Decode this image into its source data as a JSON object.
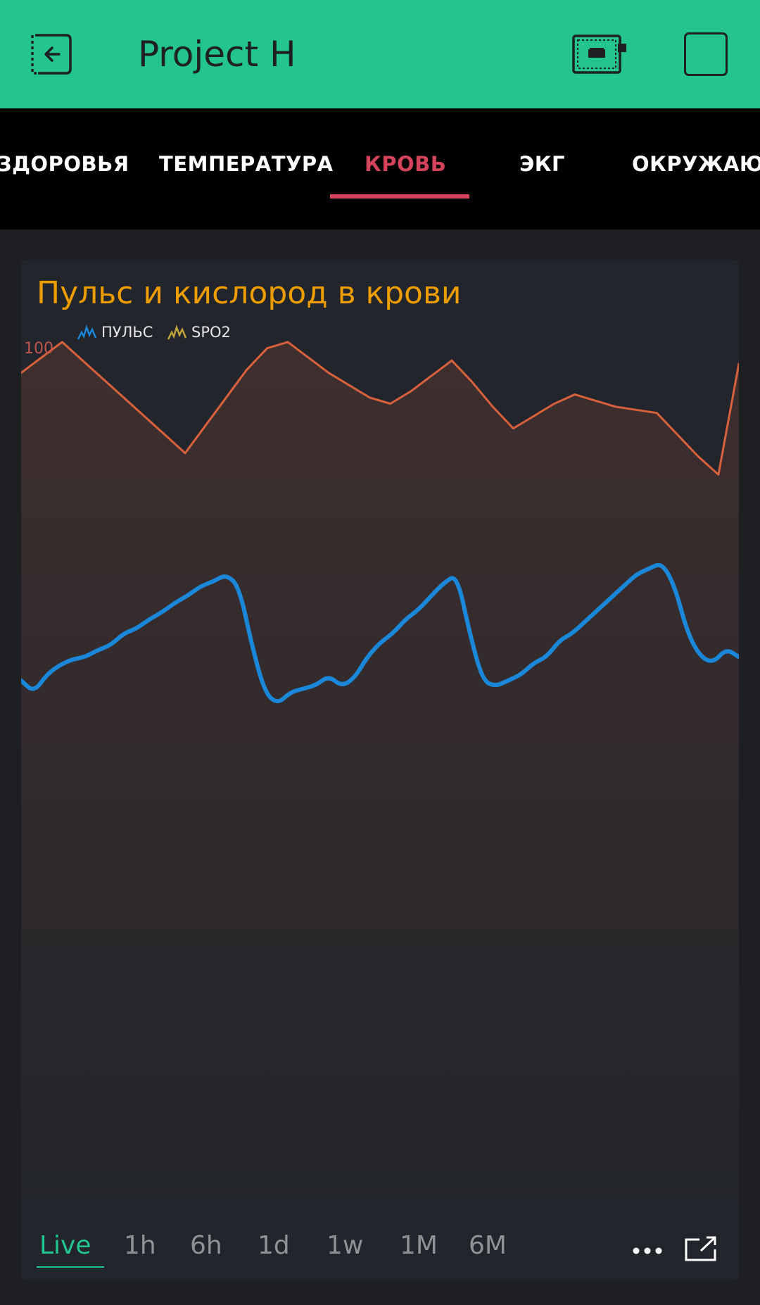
{
  "header": {
    "title": "Project H",
    "colors": {
      "bar": "#23c48e",
      "icon": "#1e2023"
    },
    "icons": {
      "back": "exit-door-icon",
      "device": "device-board-icon",
      "square": "square-icon"
    }
  },
  "tabs": {
    "items": [
      {
        "label": "ЗДОРОВЬЯ"
      },
      {
        "label": "ТЕМПЕРАТУРА"
      },
      {
        "label": "КРОВЬ",
        "active": true
      },
      {
        "label": "ЭКГ"
      },
      {
        "label": "ОКРУЖАЮЩ"
      }
    ],
    "active_color": "#d3435c"
  },
  "card": {
    "title": "Пульс и кислород в крови",
    "title_color": "#ed9d00",
    "legend": [
      {
        "label": "ПУЛЬС",
        "color": "#1a87d8"
      },
      {
        "label": "SPO2",
        "color": "#c0a43c"
      }
    ],
    "ymax_label": "100"
  },
  "chart_data": {
    "type": "line",
    "title": "Пульс и кислород в крови",
    "legend_position": "top-left",
    "grid": false,
    "x": [
      0,
      1,
      2,
      3,
      4,
      5,
      6,
      7,
      8,
      9,
      10,
      11,
      12,
      13,
      14,
      15,
      16,
      17,
      18,
      19,
      20,
      21,
      22,
      23,
      24,
      25,
      26,
      27,
      28,
      29,
      30,
      31,
      32,
      33,
      34,
      35,
      36,
      37,
      38,
      39,
      40,
      41,
      42,
      43,
      44,
      45,
      46,
      47,
      48,
      49,
      50,
      51,
      52,
      53,
      54,
      55,
      56,
      57,
      58,
      59,
      60
    ],
    "ylim": [
      0,
      100
    ],
    "series": [
      {
        "name": "SPO2",
        "color": "#d8613d",
        "fill": true,
        "values": [
          99,
          99.5,
          100,
          99.4,
          98.8,
          98.2,
          97.6,
          97,
          96.4,
          97.3,
          98.2,
          99.1,
          99.8,
          100,
          99.5,
          99,
          98.6,
          98.2,
          98,
          98.4,
          98.9,
          99.4,
          98.7,
          97.9,
          97.2,
          97.6,
          98,
          98.3,
          98.1,
          97.9,
          97.8,
          97.7,
          97,
          96.3,
          95.7,
          99.3
        ]
      },
      {
        "name": "ПУЛЬС",
        "color": "#1a87d8",
        "fill": false,
        "values": [
          62,
          61,
          62.5,
          63.3,
          63.8,
          64,
          64.6,
          65,
          66,
          66.4,
          67.2,
          67.8,
          68.6,
          69.2,
          70,
          70.4,
          71,
          70,
          65,
          61,
          60,
          61,
          61.3,
          61.6,
          62.4,
          61.5,
          62.2,
          64,
          65.2,
          66,
          67.2,
          68,
          69.2,
          70.3,
          71,
          66,
          62,
          61.5,
          62,
          62.5,
          63.5,
          64,
          65.4,
          66,
          67,
          68,
          69,
          70,
          71,
          71.5,
          72,
          70,
          66,
          64,
          63.5,
          64.7,
          64
        ]
      }
    ]
  },
  "range_selector": {
    "items": [
      "Live",
      "1h",
      "6h",
      "1d",
      "1w",
      "1M",
      "6M"
    ],
    "active": "Live",
    "more_icon": "more-dots-icon",
    "expand_icon": "expand-icon"
  }
}
